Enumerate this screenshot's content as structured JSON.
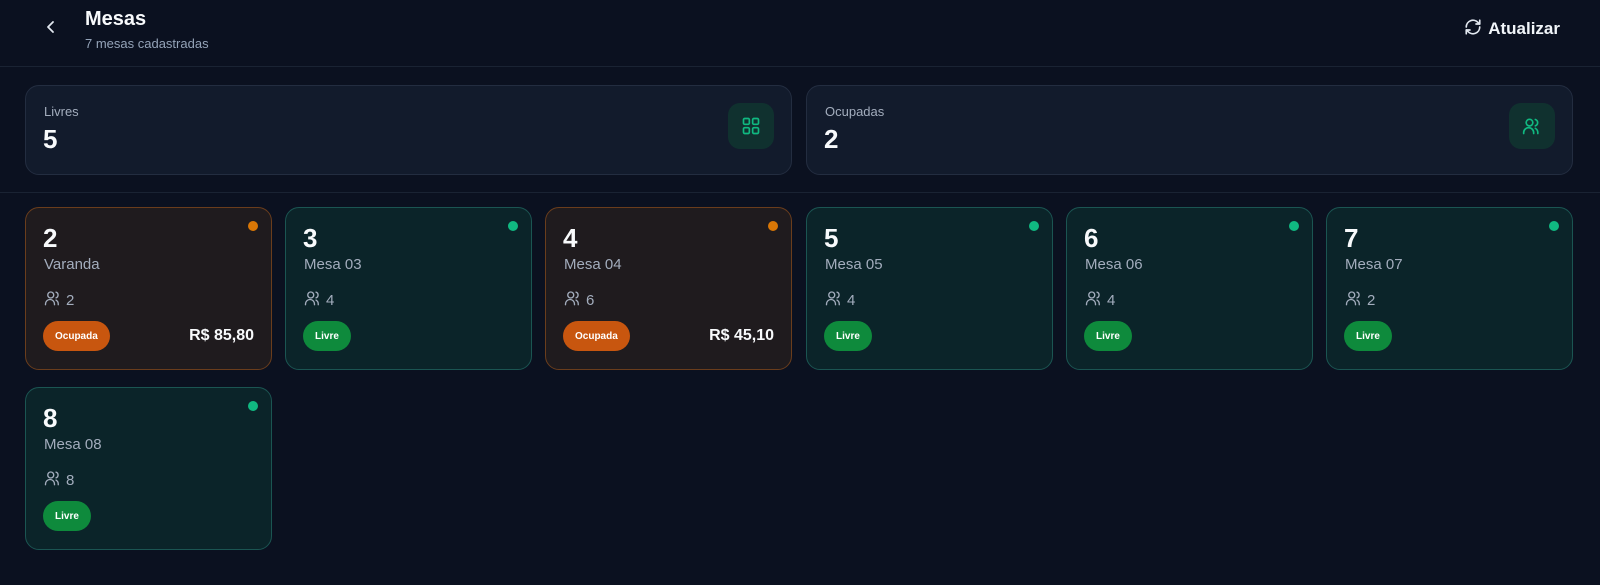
{
  "header": {
    "title": "Mesas",
    "subtitle": "7 mesas cadastradas",
    "refresh_label": "Atualizar",
    "back_icon": "chevron-left-icon",
    "refresh_icon": "refresh-icon"
  },
  "stats": {
    "free_label": "Livres",
    "free_value": "5",
    "occupied_label": "Ocupadas",
    "occupied_value": "2",
    "free_icon": "grid-icon",
    "occupied_icon": "users-icon"
  },
  "colors": {
    "background": "#0b1120",
    "free_accent": "#10b981",
    "free_badge": "#0e8a3c",
    "occupied_accent": "#d97706",
    "occupied_badge": "#c8560f"
  },
  "tables": [
    {
      "number": "2",
      "name": "Varanda",
      "seats": "2",
      "status": "Ocupada",
      "amount": "R$ 85,80"
    },
    {
      "number": "3",
      "name": "Mesa 03",
      "seats": "4",
      "status": "Livre",
      "amount": ""
    },
    {
      "number": "4",
      "name": "Mesa 04",
      "seats": "6",
      "status": "Ocupada",
      "amount": "R$ 45,10"
    },
    {
      "number": "5",
      "name": "Mesa 05",
      "seats": "4",
      "status": "Livre",
      "amount": ""
    },
    {
      "number": "6",
      "name": "Mesa 06",
      "seats": "4",
      "status": "Livre",
      "amount": ""
    },
    {
      "number": "7",
      "name": "Mesa 07",
      "seats": "2",
      "status": "Livre",
      "amount": ""
    },
    {
      "number": "8",
      "name": "Mesa 08",
      "seats": "8",
      "status": "Livre",
      "amount": ""
    }
  ]
}
